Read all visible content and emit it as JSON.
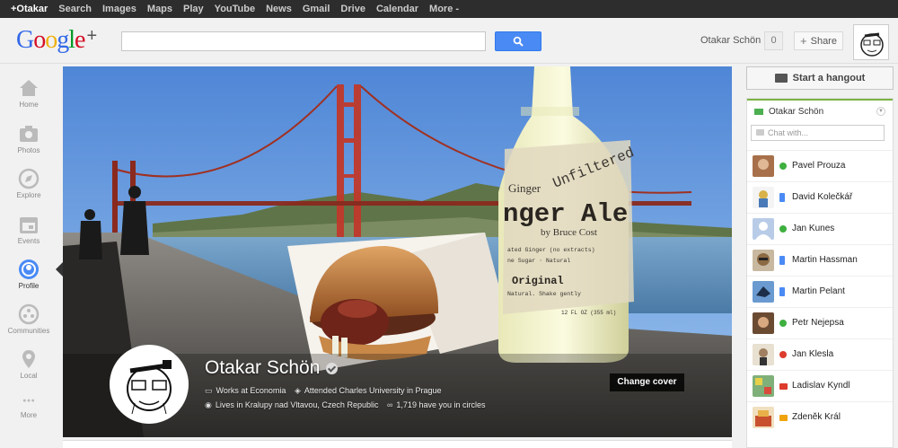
{
  "topbar": {
    "items": [
      {
        "label": "+Otakar",
        "active": true
      },
      {
        "label": "Search"
      },
      {
        "label": "Images"
      },
      {
        "label": "Maps"
      },
      {
        "label": "Play"
      },
      {
        "label": "YouTube"
      },
      {
        "label": "News"
      },
      {
        "label": "Gmail"
      },
      {
        "label": "Drive"
      },
      {
        "label": "Calendar"
      },
      {
        "label": "More -"
      }
    ]
  },
  "header": {
    "logo_plus": "+",
    "search_placeholder": "",
    "user_name": "Otakar Schön",
    "notification_count": "0",
    "share_label": "Share"
  },
  "leftnav": {
    "items": [
      {
        "label": "Home",
        "icon": "home-icon"
      },
      {
        "label": "Photos",
        "icon": "camera-icon"
      },
      {
        "label": "Explore",
        "icon": "compass-icon"
      },
      {
        "label": "Events",
        "icon": "calendar-icon"
      },
      {
        "label": "Profile",
        "icon": "profile-icon",
        "active": true
      },
      {
        "label": "Communities",
        "icon": "communities-icon"
      },
      {
        "label": "Local",
        "icon": "map-pin-icon"
      },
      {
        "label": "More",
        "icon": "more-dots-icon"
      }
    ]
  },
  "profile": {
    "name": "Otakar Schön",
    "works": "Works at Economia",
    "education": "Attended Charles University in Prague",
    "lives": "Lives in Kralupy nad Vltavou, Czech Republic",
    "circles": "1,719 have you in circles",
    "change_cover": "Change cover"
  },
  "cover_text": {
    "unfiltered": "Unfiltered",
    "ginger_top": "Ginger",
    "brand": "nger Ale",
    "by": "by Bruce Cost",
    "extracts": "ated Ginger (no extracts)",
    "cane": "ne Sugar · Natural",
    "original": "Original",
    "natural": "Natural. Shake gently",
    "volume": "12 FL OZ (355 ml)"
  },
  "hangout": {
    "label": "Start a hangout"
  },
  "chat": {
    "self_name": "Otakar Schön",
    "input_placeholder": "Chat with...",
    "contacts": [
      {
        "name": "Pavel Prouza",
        "status": "green",
        "avatar_color": "#a8704a"
      },
      {
        "name": "David Kolečkář",
        "status": "mobile",
        "avatar_color": "#d9b24a"
      },
      {
        "name": "Jan Kunes",
        "status": "green",
        "avatar_color": "#b8cce8"
      },
      {
        "name": "Martin Hassman",
        "status": "mobile",
        "avatar_color": "#8c6a44"
      },
      {
        "name": "Martin Pelant",
        "status": "mobile",
        "avatar_color": "#3b5f8c"
      },
      {
        "name": "Petr Nejepsa",
        "status": "green",
        "avatar_color": "#6b4a32"
      },
      {
        "name": "Jan Klesla",
        "status": "red",
        "avatar_color": "#e8e0d0"
      },
      {
        "name": "Ladislav Kyndl",
        "status": "vred",
        "avatar_color": "#7fb07a"
      },
      {
        "name": "Zdeněk Král",
        "status": "vorange",
        "avatar_color": "#c8502e"
      }
    ]
  }
}
